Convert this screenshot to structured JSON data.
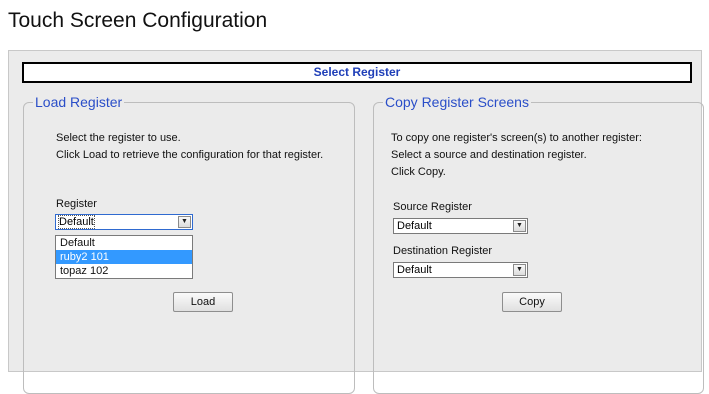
{
  "page": {
    "title": "Touch Screen Configuration"
  },
  "header": {
    "title": "Select Register"
  },
  "load": {
    "legend": "Load Register",
    "line1": "Select the register to use.",
    "line2": "Click Load to retrieve the configuration for that register.",
    "register_label": "Register",
    "register_value": "Default",
    "options": [
      "Default",
      "ruby2 101",
      "topaz 102"
    ],
    "highlighted_option": "ruby2 101",
    "button": "Load"
  },
  "copy": {
    "legend": "Copy Register Screens",
    "line1": "To copy one register's screen(s) to another register:",
    "line2": "Select a source and destination register.",
    "line3": "Click Copy.",
    "source_label": "Source Register",
    "source_value": "Default",
    "destination_label": "Destination Register",
    "destination_value": "Default",
    "button": "Copy"
  },
  "icons": {
    "dropdown_arrow": "▼"
  }
}
